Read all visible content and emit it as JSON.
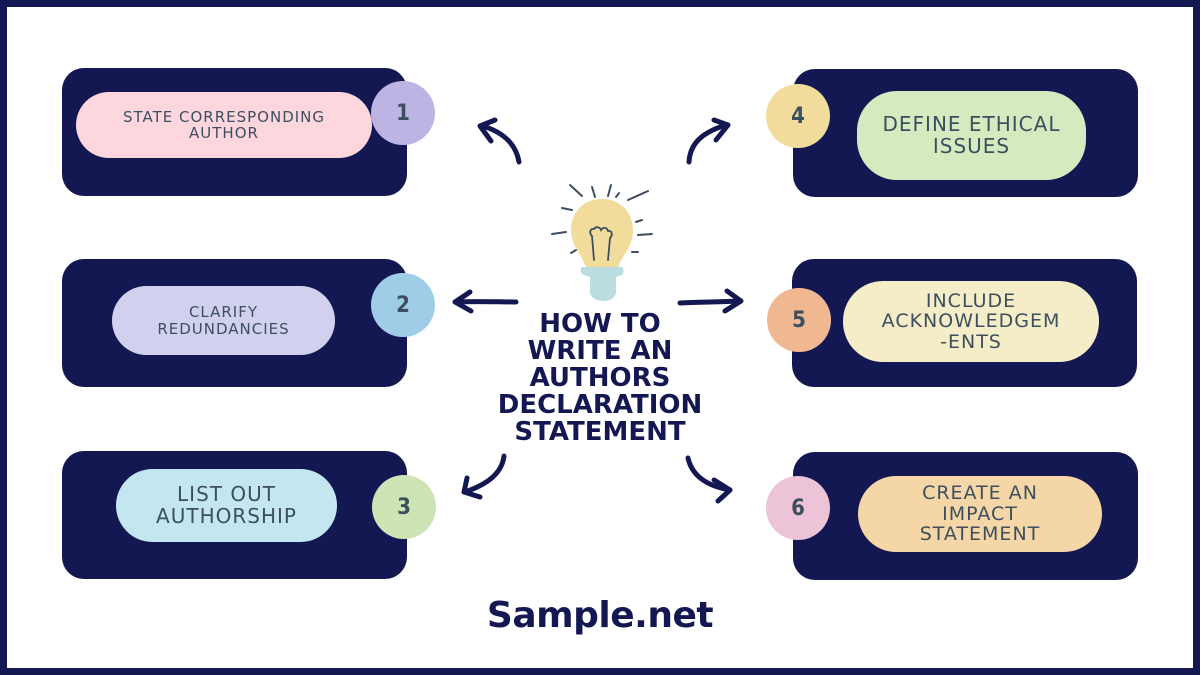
{
  "title": [
    "HOW TO",
    "WRITE AN",
    "AUTHORS",
    "DECLARATION",
    "STATEMENT"
  ],
  "brand": "Sample.net",
  "colors": {
    "navy": "#141852",
    "text": "#3d4f5f",
    "bulb": "#f2dc9b",
    "bulb_base": "#bcdde0"
  },
  "steps": [
    {
      "number": "1",
      "lines": [
        "STATE CORRESPONDING",
        "AUTHOR"
      ],
      "pill_color": "#fdd7dd",
      "badge_color": "#bcb4e3"
    },
    {
      "number": "2",
      "lines": [
        "CLARIFY",
        "REDUNDANCIES"
      ],
      "pill_color": "#d1d1ef",
      "badge_color": "#9fcde8"
    },
    {
      "number": "3",
      "lines": [
        "LIST OUT",
        "AUTHORSHIP"
      ],
      "pill_color": "#c3e6f0",
      "badge_color": "#cfe4b5"
    },
    {
      "number": "4",
      "lines": [
        "DEFINE ETHICAL",
        "ISSUES"
      ],
      "pill_color": "#d5eabf",
      "badge_color": "#f2dc9b"
    },
    {
      "number": "5",
      "lines": [
        "INCLUDE",
        "ACKNOWLEDGEM",
        "-ENTS"
      ],
      "pill_color": "#f4edc7",
      "badge_color": "#f0b891"
    },
    {
      "number": "6",
      "lines": [
        "CREATE AN",
        "IMPACT",
        "STATEMENT"
      ],
      "pill_color": "#f5d6a6",
      "badge_color": "#ecc3d7"
    }
  ]
}
